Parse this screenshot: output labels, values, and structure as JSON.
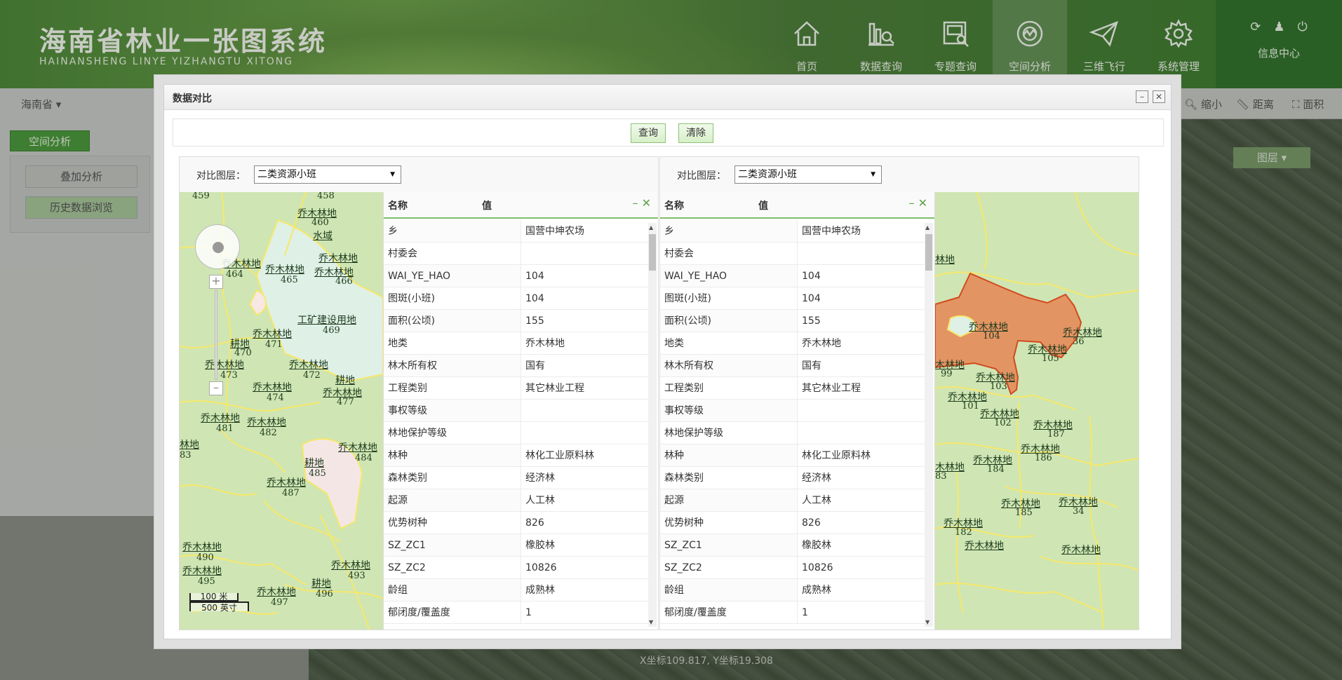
{
  "header": {
    "title": "海南省林业一张图系统",
    "subtitle": "HAINANSHENG LINYE YIZHANGTU XITONG",
    "nav": [
      {
        "label": "首页",
        "icon": "home-icon"
      },
      {
        "label": "数据查询",
        "icon": "data-query-icon"
      },
      {
        "label": "专题查询",
        "icon": "topic-query-icon"
      },
      {
        "label": "空间分析",
        "icon": "spatial-analysis-icon"
      },
      {
        "label": "三维飞行",
        "icon": "paper-plane-icon"
      },
      {
        "label": "系统管理",
        "icon": "gear-icon"
      }
    ],
    "info_center": "信息中心"
  },
  "leftbar": {
    "province": "海南省",
    "tab": "空间分析",
    "buttons": [
      "叠加分析",
      "历史数据浏览"
    ]
  },
  "toolbar": {
    "shrink": "缩小",
    "distance": "距离",
    "area": "面积",
    "layer": "图层"
  },
  "status": {
    "coord": "X坐标109.817, Y坐标19.308"
  },
  "dialog": {
    "title": "数据对比",
    "query_btn": "查询",
    "clear_btn": "清除",
    "layer_label": "对比图层：",
    "left_layer": "二类资源小班",
    "right_layer": "二类资源小班",
    "col_name": "名称",
    "col_value": "值",
    "scale_m": "100 米",
    "scale_ft": "500 英寸",
    "rows": [
      {
        "k": "乡",
        "v": "国营中坤农场"
      },
      {
        "k": "村委会",
        "v": ""
      },
      {
        "k": "WAI_YE_HAO",
        "v": "104"
      },
      {
        "k": "图斑(小班)",
        "v": "104"
      },
      {
        "k": "面积(公顷)",
        "v": "155"
      },
      {
        "k": "地类",
        "v": "乔木林地"
      },
      {
        "k": "林木所有权",
        "v": "国有"
      },
      {
        "k": "工程类别",
        "v": "其它林业工程"
      },
      {
        "k": "事权等级",
        "v": ""
      },
      {
        "k": "林地保护等级",
        "v": ""
      },
      {
        "k": "林种",
        "v": "林化工业原料林"
      },
      {
        "k": "森林类别",
        "v": "经济林"
      },
      {
        "k": "起源",
        "v": "人工林"
      },
      {
        "k": "优势树种",
        "v": "826"
      },
      {
        "k": "SZ_ZC1",
        "v": "橡胶林"
      },
      {
        "k": "SZ_ZC2",
        "v": "10826"
      },
      {
        "k": "龄组",
        "v": "成熟林"
      },
      {
        "k": "郁闭度/覆盖度",
        "v": "1"
      }
    ]
  },
  "colors": {
    "accent": "#4c9a3d",
    "highlight": "#e39463",
    "map_bg": "#d1e6b6"
  }
}
